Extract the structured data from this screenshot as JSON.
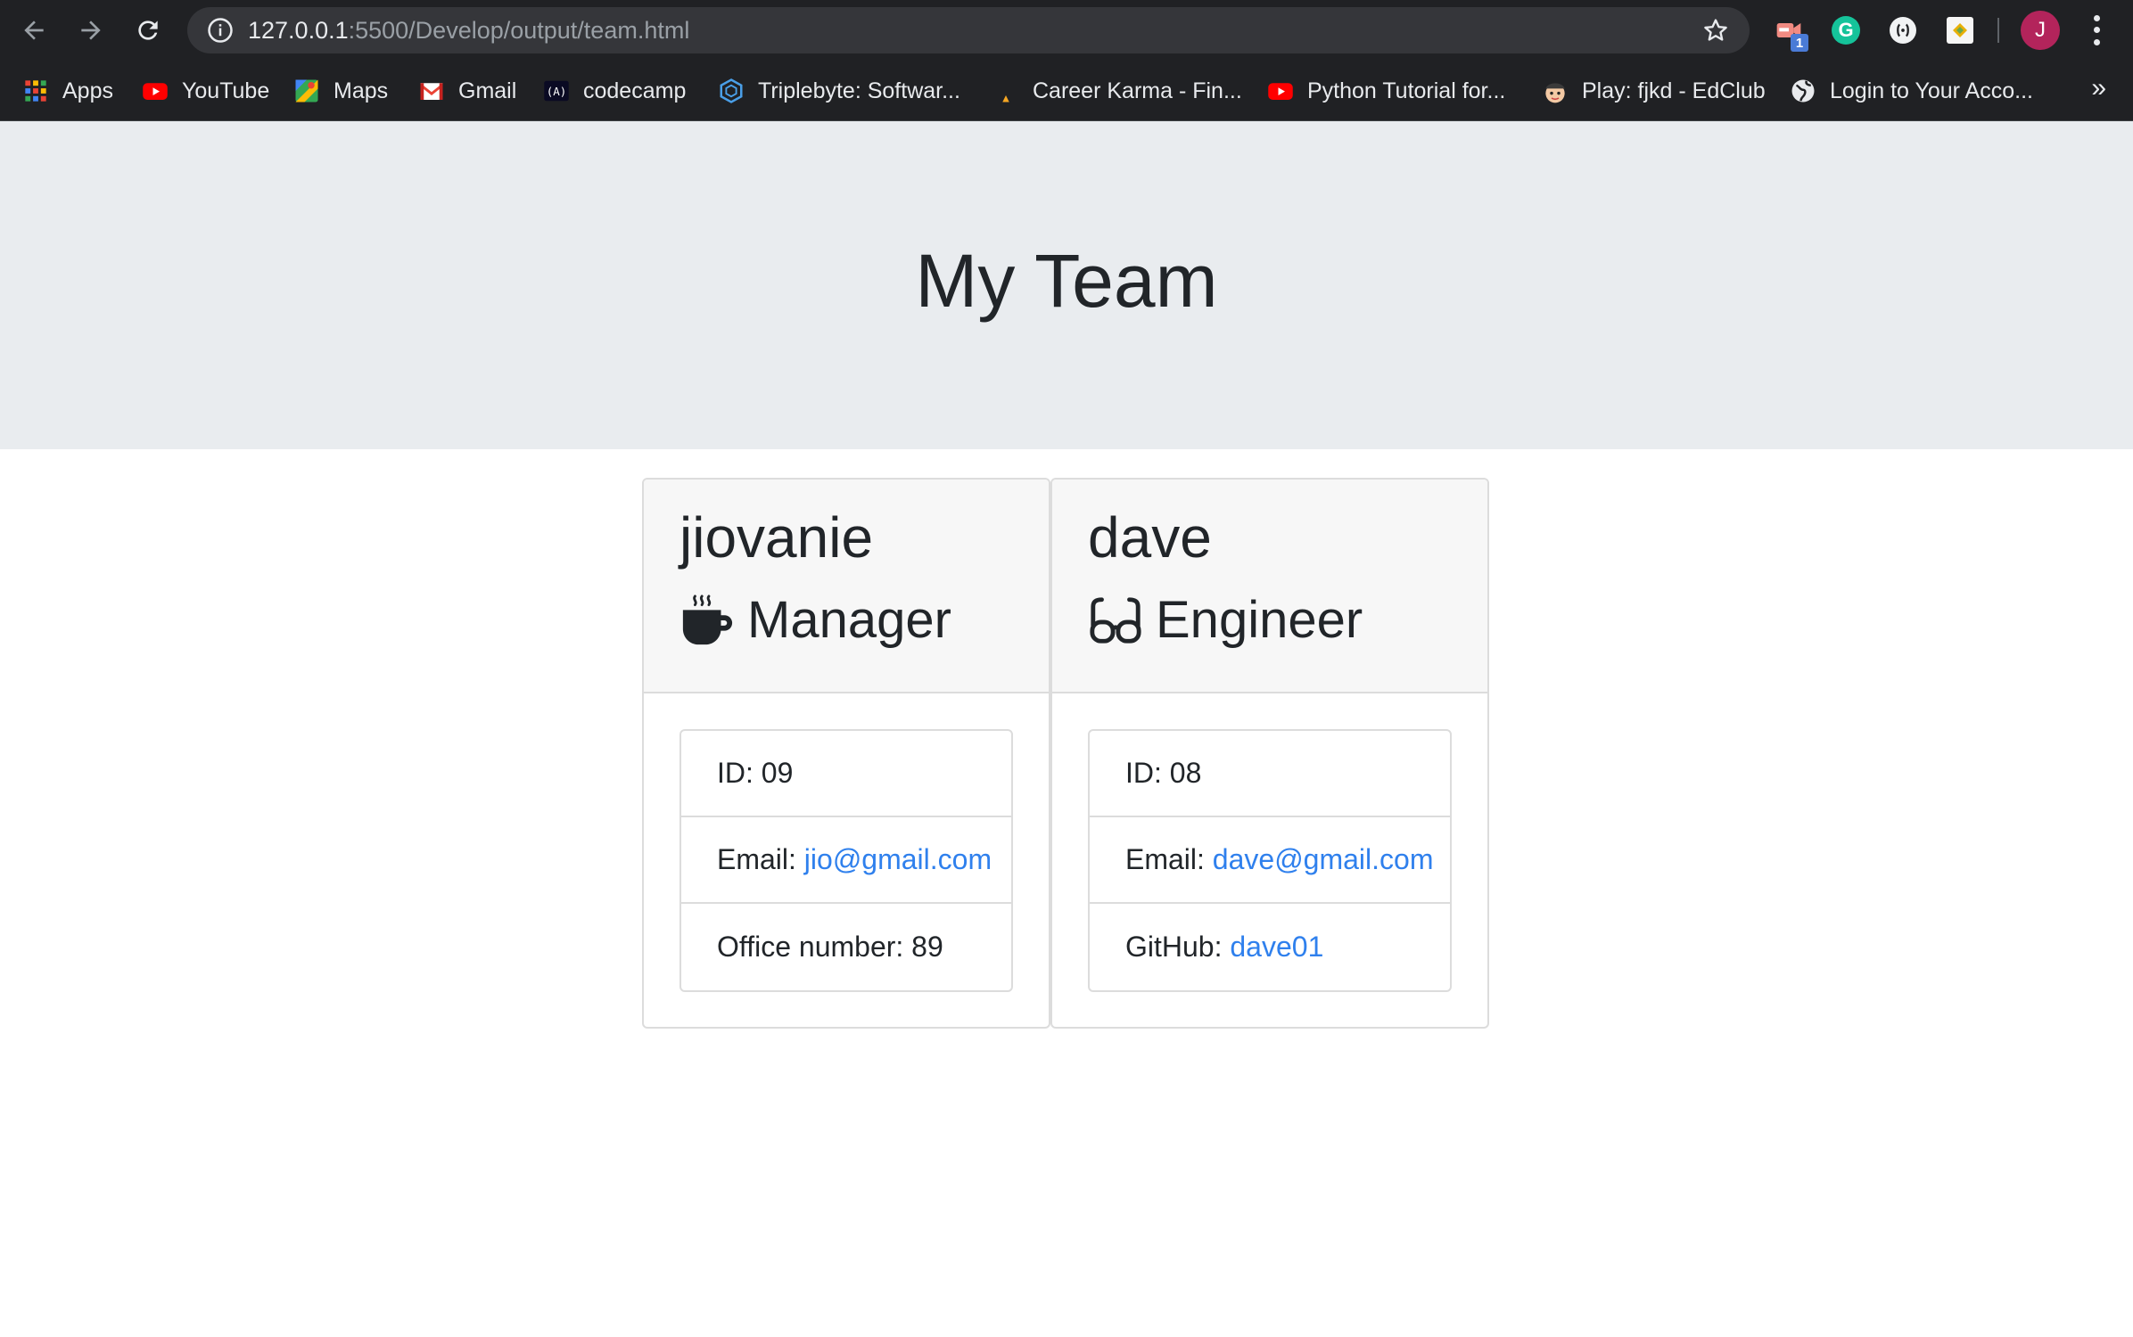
{
  "browser": {
    "url_host": "127.0.0.1",
    "url_path": ":5500/Develop/output/team.html",
    "extension_badge": "1",
    "grammarly_letter": "G",
    "profile_initial": "J",
    "more_bookmarks": "»",
    "bookmarks": [
      {
        "label": "Apps",
        "icon": "apps-grid-icon"
      },
      {
        "label": "YouTube",
        "icon": "youtube-icon"
      },
      {
        "label": "Maps",
        "icon": "maps-icon"
      },
      {
        "label": "Gmail",
        "icon": "gmail-icon"
      },
      {
        "label": "codecamp",
        "icon": "freecodecamp-icon"
      },
      {
        "label": "Triplebyte: Softwar...",
        "icon": "triplebyte-icon"
      },
      {
        "label": "Career Karma - Fin...",
        "icon": "career-karma-icon"
      },
      {
        "label": "Python Tutorial for...",
        "icon": "youtube-icon"
      },
      {
        "label": "Play: fjkd - EdClub",
        "icon": "edclub-icon"
      },
      {
        "label": "Login to Your Acco...",
        "icon": "globe-icon"
      }
    ]
  },
  "page": {
    "title": "My Team"
  },
  "team": [
    {
      "name": "jiovanie",
      "role": "Manager",
      "role_icon": "mug-icon",
      "id_label": "ID: 09",
      "email_label": "Email: ",
      "email": "jio@gmail.com",
      "extra_label": "Office number: 89"
    },
    {
      "name": "dave",
      "role": "Engineer",
      "role_icon": "glasses-icon",
      "id_label": "ID: 08",
      "email_label": "Email: ",
      "email": "dave@gmail.com",
      "extra_label": "GitHub: ",
      "extra_link": "dave01"
    }
  ],
  "colors": {
    "jumbotron": "#e9ecef",
    "link": "#2f80ed",
    "card_header": "#f7f7f7"
  }
}
